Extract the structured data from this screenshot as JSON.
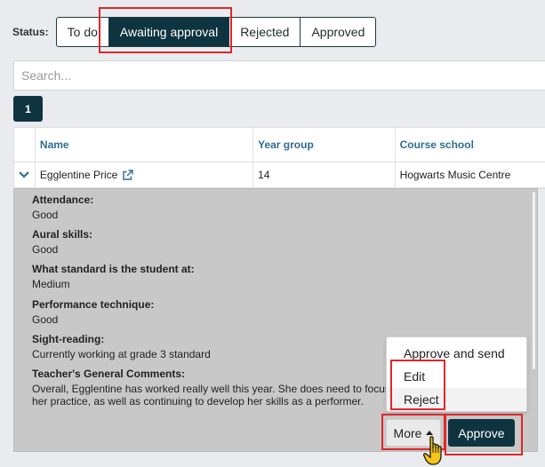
{
  "status": {
    "label": "Status:",
    "tabs": [
      {
        "label": "To do"
      },
      {
        "label": "Awaiting approval",
        "active": true
      },
      {
        "label": "Rejected"
      },
      {
        "label": "Approved"
      }
    ]
  },
  "search": {
    "placeholder": "Search..."
  },
  "pagination": {
    "current": "1"
  },
  "table": {
    "columns": [
      "Name",
      "Year group",
      "Course school"
    ],
    "rows": [
      {
        "name": "Egglentine Price",
        "year_group": "14",
        "course_school": "Hogwarts Music Centre",
        "expanded": true
      }
    ]
  },
  "detail": {
    "fields": [
      {
        "label": "Attendance:",
        "value": "Good"
      },
      {
        "label": "Aural skills:",
        "value": "Good"
      },
      {
        "label": "What standard is the student at:",
        "value": "Medium"
      },
      {
        "label": "Performance technique:",
        "value": "Good"
      },
      {
        "label": "Sight-reading:",
        "value": "Currently working at grade 3 standard"
      },
      {
        "label": "Teacher's General Comments:",
        "value": "Overall, Egglentine has worked really well this year. She does need to focus on her practice, as well as continuing to develop her skills as a performer."
      }
    ]
  },
  "more_menu": {
    "items": [
      "Approve and send",
      "Edit",
      "Reject"
    ]
  },
  "actions": {
    "more_label": "More",
    "approve_label": "Approve"
  },
  "colors": {
    "primary": "#0e3440",
    "link": "#2e6d91",
    "highlight": "#e0262b"
  }
}
